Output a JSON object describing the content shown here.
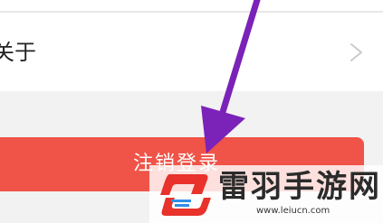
{
  "settings": {
    "about_label": "关于",
    "logout_label": "注销登录"
  },
  "icons": {
    "chevron": "chevron-right-icon",
    "arrow": "annotation-arrow",
    "logo": "leiyu-logo"
  },
  "watermark": {
    "name": "雷羽手游网",
    "url": "www.leiucn.com"
  },
  "colors": {
    "logout_button": "#f05448",
    "arrow": "#7b22b8",
    "logo_red": "#e8322b",
    "logo_blue": "#2f8fe6"
  }
}
